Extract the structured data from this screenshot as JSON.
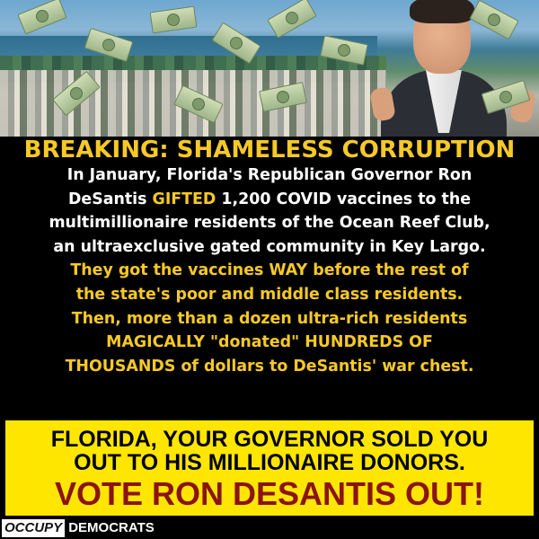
{
  "headline": "BREAKING: SHAMELESS CORRUPTION",
  "body": {
    "line1": "In January, Florida's Republican Governor Ron",
    "line2_a": "DeSantis ",
    "line2_b": "GIFTED",
    "line2_c": " 1,200 COVID vaccines to the",
    "line3": "multimillionaire residents of the Ocean Reef Club,",
    "line4": "an ultraexclusive gated community in Key Largo.",
    "line5_a": "They got the vaccines ",
    "line5_b": "WAY",
    "line5_c": " before the rest of",
    "line6": "the state's poor and middle class residents.",
    "line7": "Then, more than a dozen ultra-rich residents",
    "line8": "MAGICALLY \"donated\" HUNDREDS OF",
    "line9": "THOUSANDS of dollars to DeSantis' war chest."
  },
  "banner": {
    "line1": "FLORIDA, YOUR GOVERNOR SOLD YOU",
    "line2": "OUT TO HIS MILLIONAIRE DONORS.",
    "line3": "VOTE RON DESANTIS OUT!"
  },
  "logo": {
    "occupy": "OCCUPY",
    "democrats": "DEMOCRATS"
  },
  "colors": {
    "headline": "#f7c927",
    "banner_bg": "#ffe600",
    "banner_cta": "#8a1414"
  }
}
